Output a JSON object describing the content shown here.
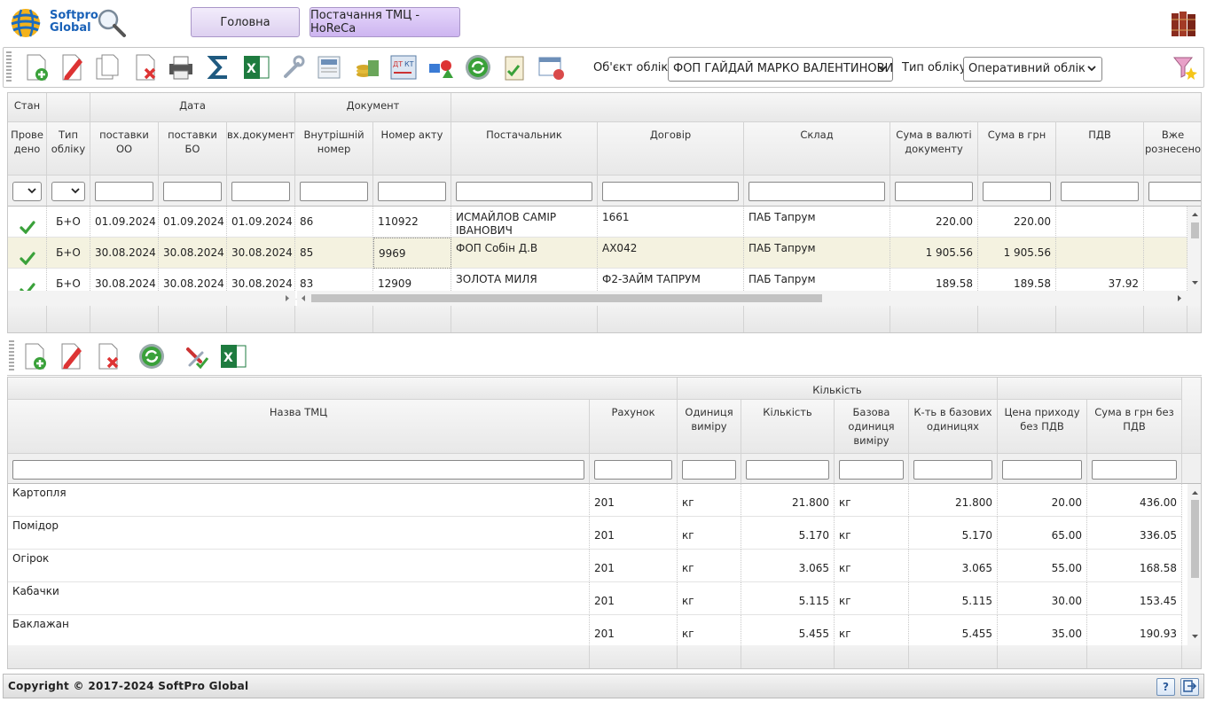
{
  "header": {
    "logo_line1": "Softpro",
    "logo_line2": "Global",
    "tab_home": "Головна",
    "tab_supply": "Постачання ТМЦ - HoReCa"
  },
  "toolbar": {
    "object_label": "Об'єкт обліку",
    "object_value": "ФОП ГАЙДАЙ МАРКО ВАЛЕНТИНОВИЧ",
    "type_label": "Тип обліку",
    "type_value": "Оперативний облік"
  },
  "grid1": {
    "group_headers": {
      "stan": "Стан",
      "data": "Дата",
      "document": "Документ"
    },
    "columns": [
      "Прове дено",
      "Тип обліку",
      "поставки ОО",
      "поставки БО",
      "вх.документу",
      "Внутрішній номер",
      "Номер акту",
      "Постачальник",
      "Договір",
      "Склад",
      "Сума в валюті документу",
      "Сума в грн",
      "ПДВ",
      "Вже рознесено"
    ],
    "rows": [
      {
        "type": "Б+О",
        "d1": "01.09.2024",
        "d2": "01.09.2024",
        "d3": "01.09.2024",
        "inner": "86",
        "act": "110922",
        "supplier": "ИСМАЙЛОВ САМІР",
        "supplier2": "ІВАНОВИЧ",
        "contract": "1661",
        "store": "ПАБ Тапрум",
        "sum_doc": "220.00",
        "sum_uah": "220.00",
        "vat": ""
      },
      {
        "type": "Б+О",
        "d1": "30.08.2024",
        "d2": "30.08.2024",
        "d3": "30.08.2024",
        "inner": "85",
        "act": "9969",
        "supplier": "ФОП Собін Д.В",
        "supplier2": "",
        "contract": "АХ042",
        "store": "ПАБ Тапрум",
        "sum_doc": "1 905.56",
        "sum_uah": "1 905.56",
        "vat": ""
      },
      {
        "type": "Б+О",
        "d1": "30.08.2024",
        "d2": "30.08.2024",
        "d3": "30.08.2024",
        "inner": "83",
        "act": "12909",
        "supplier": "ЗОЛОТА МИЛЯ",
        "supplier2": "",
        "contract": "Ф2-ЗАЙМ ТАПРУМ",
        "store": "ПАБ Тапрум",
        "sum_doc": "189.58",
        "sum_uah": "189.58",
        "vat": "37.92"
      }
    ]
  },
  "grid2": {
    "group_headers": {
      "qty": "Кількість"
    },
    "columns": [
      "Назва ТМЦ",
      "Рахунок",
      "Одиниця виміру",
      "Кількість",
      "Базова одиниця виміру",
      "К-ть в базових одиницях",
      "Цена приходу без ПДВ",
      "Сума в грн без ПДВ"
    ],
    "rows": [
      {
        "name": "Картопля",
        "acc": "201",
        "unit": "кг",
        "qty": "21.800",
        "bunit": "кг",
        "bqty": "21.800",
        "price": "20.00",
        "sum": "436.00"
      },
      {
        "name": "Помідор",
        "acc": "201",
        "unit": "кг",
        "qty": "5.170",
        "bunit": "кг",
        "bqty": "5.170",
        "price": "65.00",
        "sum": "336.05"
      },
      {
        "name": "Огірок",
        "acc": "201",
        "unit": "кг",
        "qty": "3.065",
        "bunit": "кг",
        "bqty": "3.065",
        "price": "55.00",
        "sum": "168.58"
      },
      {
        "name": "Кабачки",
        "acc": "201",
        "unit": "кг",
        "qty": "5.115",
        "bunit": "кг",
        "bqty": "5.115",
        "price": "30.00",
        "sum": "153.45"
      },
      {
        "name": "Баклажан",
        "acc": "201",
        "unit": "кг",
        "qty": "5.455",
        "bunit": "кг",
        "bqty": "5.455",
        "price": "35.00",
        "sum": "190.93"
      }
    ]
  },
  "footer": {
    "copyright": "Copyright © 2017-2024 SoftPro Global",
    "help": "?"
  },
  "colors": {
    "accent": "#1a62b8",
    "tab_border": "#a996c8",
    "selected_row": "#f4f2e0",
    "check": "#3aa13a"
  }
}
